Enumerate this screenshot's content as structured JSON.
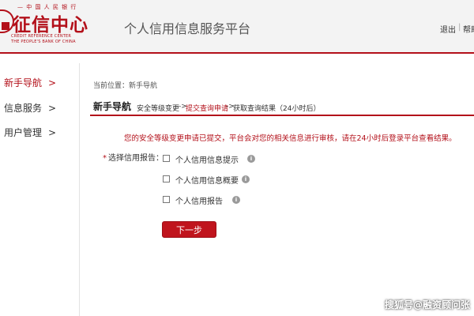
{
  "header": {
    "logo": {
      "cn_top": "— 中 国 人 民 银 行",
      "cn_name": "征信中心",
      "en_line1": "CREDIT REFERENCE CENTER",
      "en_line2": "THE PEOPLE'S BANK OF CHINA"
    },
    "site_title": "个人信用信息服务平台",
    "logout": "退出",
    "separator": "|",
    "help": "帮助"
  },
  "sidebar": {
    "items": [
      {
        "label": "新手导航",
        "chevron": ">",
        "active": true
      },
      {
        "label": "信息服务",
        "chevron": ">",
        "active": false
      },
      {
        "label": "用户管理",
        "chevron": ">",
        "active": false
      }
    ]
  },
  "main": {
    "breadcrumb": "当前位置：新手导航",
    "steps": {
      "title": "新手导航",
      "items": [
        {
          "label": "安全等级变更",
          "current": false
        },
        {
          "label": "提交查询申请",
          "current": true
        },
        {
          "label": "获取查询结果（24小时后）",
          "current": false
        }
      ],
      "arrow": "->"
    },
    "notice": "您的安全等级变更申请已提交，平台会对您的相关信息进行审核，请在24小时后登录平台查看结果。",
    "report_select": {
      "required_mark": "*",
      "label": "选择信用报告：",
      "options": [
        {
          "label": "个人信用信息提示",
          "checked": false,
          "info_icon": "info-icon"
        },
        {
          "label": "个人信用信息概要",
          "checked": false,
          "info_icon": "info-icon"
        },
        {
          "label": "个人信用报告",
          "checked": false,
          "info_icon": "info-icon"
        }
      ],
      "info_glyph": "i"
    },
    "next_button": "下一步"
  },
  "watermark": "搜狐号@融资顾问张",
  "colors": {
    "brand_red": "#b3101a",
    "button_red": "#c0141d",
    "header_bg": "#f3f3f3"
  }
}
